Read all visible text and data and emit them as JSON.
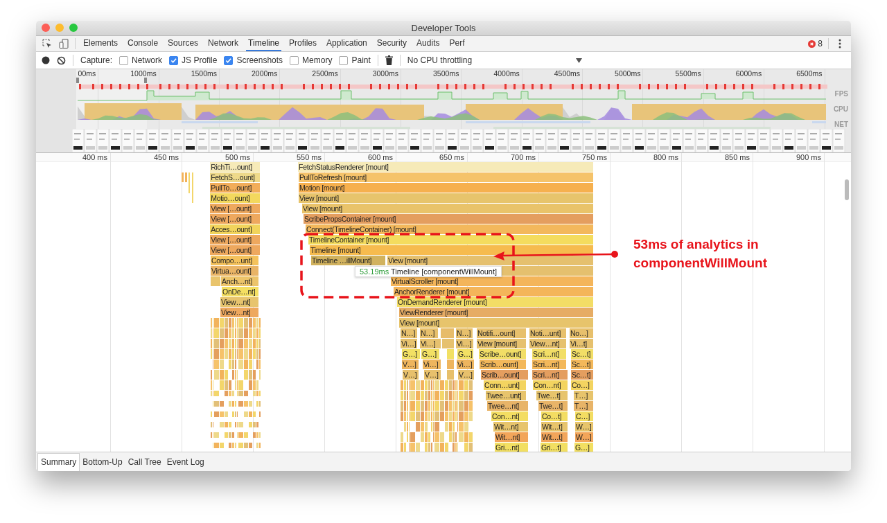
{
  "window": {
    "title": "Developer Tools"
  },
  "tabs": [
    {
      "label": "Elements",
      "selected": false
    },
    {
      "label": "Console",
      "selected": false
    },
    {
      "label": "Sources",
      "selected": false
    },
    {
      "label": "Network",
      "selected": false
    },
    {
      "label": "Timeline",
      "selected": true
    },
    {
      "label": "Profiles",
      "selected": false
    },
    {
      "label": "Application",
      "selected": false
    },
    {
      "label": "Security",
      "selected": false
    },
    {
      "label": "Audits",
      "selected": false
    },
    {
      "label": "Perf",
      "selected": false
    }
  ],
  "error_count": "8",
  "toolbar": {
    "capture_label": "Capture:",
    "options": [
      {
        "label": "Network",
        "checked": false
      },
      {
        "label": "JS Profile",
        "checked": true
      },
      {
        "label": "Screenshots",
        "checked": true
      },
      {
        "label": "Memory",
        "checked": false
      },
      {
        "label": "Paint",
        "checked": false
      }
    ],
    "throttling": "No CPU throttling"
  },
  "overview": {
    "ticks": [
      "00ms",
      "1000ms",
      "1500ms",
      "2000ms",
      "2500ms",
      "3000ms",
      "3500ms",
      "4000ms",
      "4500ms",
      "5000ms",
      "5500ms",
      "6000ms",
      "6500ms"
    ],
    "tracks": [
      "FPS",
      "CPU",
      "NET"
    ]
  },
  "flame_chart": {
    "ticks": [
      "400 ms",
      "450 ms",
      "500 ms",
      "550 ms",
      "600 ms",
      "650 ms",
      "700 ms",
      "750 ms",
      "800 ms",
      "850 ms",
      "900 ms"
    ],
    "rows": [
      [
        {
          "label": "RichTi…ount]",
          "color": "#f6eab8"
        },
        {
          "label": "FetchStatusRenderer [mount]",
          "color": "#f6eab8"
        }
      ],
      [
        {
          "label": "FetchS…ount]",
          "color": "#eed98a"
        },
        {
          "label": "PullToRefresh [mount]",
          "color": "#f5c36a"
        }
      ],
      [
        {
          "label": "PullTo…ount]",
          "color": "#f2ad5a"
        },
        {
          "label": "Motion [mount]",
          "color": "#f6b04e"
        }
      ],
      [
        {
          "label": "Motio…ount]",
          "color": "#f3d85e"
        },
        {
          "label": "View [mount]",
          "color": "#e7c46c"
        }
      ],
      [
        {
          "label": "View […ount]",
          "color": "#eea85e"
        },
        {
          "label": "View [mount]",
          "color": "#e9c36a"
        }
      ],
      [
        {
          "label": "View […ount]",
          "color": "#eea85e"
        },
        {
          "label": "ScribePropsContainer [mount]",
          "color": "#e49e5f"
        }
      ],
      [
        {
          "label": "Acces…ount]",
          "color": "#f1d45c"
        },
        {
          "label": "Connect(TimelineContainer) [mount]",
          "color": "#f3b85c"
        }
      ],
      [
        {
          "label": "View […ount]",
          "color": "#eea85e"
        },
        {
          "label": "TimelineContainer [mount]",
          "color": "#f4dc5e"
        }
      ],
      [
        {
          "label": "View […ount]",
          "color": "#eea85e"
        },
        {
          "label": "Timeline [mount]",
          "color": "#f6bb4e"
        }
      ],
      [
        {
          "label": "Compo…unt]",
          "color": "#f4c25c"
        },
        {
          "label": "Timeline …illMount]",
          "color": "#d1b25e"
        },
        {
          "label": "View [mount]",
          "color": "#e5c06e"
        }
      ],
      [
        {
          "label": "Virtua…ount]",
          "color": "#e9b466"
        },
        {}
      ],
      [
        {
          "color": "#e9c46c"
        },
        {
          "label": "Anch…nt]",
          "color": "#ecc46a"
        },
        {
          "label": "VirtualScroller [mount]",
          "color": "#f4b55a"
        }
      ],
      [
        {
          "label": "OnDe…nt]",
          "color": "#f4df62"
        },
        {
          "label": "AnchorRenderer [mount]",
          "color": "#f4b55a"
        }
      ],
      [
        {
          "label": "View…nt]",
          "color": "#e7c46e"
        },
        {
          "label": "OnDemandRenderer [mount]",
          "color": "#f3dd66"
        }
      ],
      [
        {
          "label": "View…nt]",
          "color": "#eea85e"
        },
        {
          "label": "ViewRenderer [mount]",
          "color": "#e6ac64"
        }
      ],
      [
        {
          "label": "View [mount]",
          "color": "#e7c46c"
        }
      ],
      [
        {
          "label": "N…]",
          "color": "#e7c06c"
        },
        {
          "label": "N…]",
          "color": "#e7c06c"
        },
        {
          "color": "#e7bc6a"
        },
        {
          "label": "N…]",
          "color": "#e7c06c"
        },
        {
          "label": "Notifi…ount]",
          "color": "#e7c06c"
        },
        {
          "label": "Noti…unt]",
          "color": "#e7c06c"
        },
        {
          "label": "No…]",
          "color": "#e7c06c"
        }
      ],
      [
        {
          "label": "Vi…]",
          "color": "#e6c16e"
        },
        {
          "label": "Vi…]",
          "color": "#e6c16e"
        },
        {
          "color": "#e6c16e"
        },
        {
          "label": "Vi…]",
          "color": "#e6c16e"
        },
        {
          "label": "View [mount]",
          "color": "#e6c16e"
        },
        {
          "label": "View…nt]",
          "color": "#e6c16e"
        },
        {
          "label": "Vi…t]",
          "color": "#e6c16e"
        }
      ],
      [
        {
          "label": "G…]",
          "color": "#f2e064"
        },
        {
          "label": "G…]",
          "color": "#f2e064"
        },
        {
          "color": "#f2e064"
        },
        {
          "label": "G…]",
          "color": "#f2e064"
        },
        {
          "label": "Scribe…ount]",
          "color": "#f2de66"
        },
        {
          "label": "Scri…nt]",
          "color": "#f2de66"
        },
        {
          "label": "Sc…t]",
          "color": "#f2de66"
        }
      ],
      [
        {
          "label": "V…]",
          "color": "#eeb55e"
        },
        {
          "label": "Vi…]",
          "color": "#eeb55e"
        },
        {
          "color": "#eeb55e"
        },
        {
          "label": "Vi…]",
          "color": "#eeb55e"
        },
        {
          "label": "Scrib…ount]",
          "color": "#f3b85a"
        },
        {
          "label": "Scri…nt]",
          "color": "#f3b85a"
        },
        {
          "label": "Sc…t]",
          "color": "#f3b85a"
        }
      ],
      [
        {
          "label": "V…]",
          "color": "#e7c06c"
        },
        {
          "label": "V…]",
          "color": "#e7c06c"
        },
        {
          "color": "#e7c06c"
        },
        {
          "label": "V…]",
          "color": "#e7c06c"
        },
        {
          "label": "Scrib…ount]",
          "color": "#e49e5f"
        },
        {
          "label": "Scri…nt]",
          "color": "#e49e5f"
        },
        {
          "label": "Sc…t]",
          "color": "#e49e5f"
        }
      ],
      [
        {
          "label": "Conn…unt]",
          "color": "#f3d460"
        },
        {
          "label": "Con…nt]",
          "color": "#f3d460"
        },
        {
          "label": "Co…]",
          "color": "#f3d460"
        }
      ],
      [
        {
          "label": "Twee…unt]",
          "color": "#e7c46c"
        },
        {
          "label": "Twe…t]",
          "color": "#e7c46c"
        },
        {
          "label": "T…]",
          "color": "#e7c46c"
        }
      ],
      [
        {
          "label": "Twee…nt]",
          "color": "#e8b468"
        },
        {
          "label": "Twe…t]",
          "color": "#e8b468"
        },
        {
          "label": "T…]",
          "color": "#e8b468"
        }
      ],
      [
        {
          "label": "Con…nt]",
          "color": "#f3dd62"
        },
        {
          "label": "Co…t]",
          "color": "#f3dd62"
        },
        {
          "label": "C…]",
          "color": "#f3dd62"
        }
      ],
      [
        {
          "label": "Wit…nt]",
          "color": "#e7c46c"
        },
        {
          "label": "Wit…t]",
          "color": "#e7c46c"
        },
        {
          "label": "W…]",
          "color": "#e7c46c"
        }
      ],
      [
        {
          "label": "Wit…nt]",
          "color": "#f2a55a"
        },
        {
          "label": "Wit…t]",
          "color": "#f2a55a"
        },
        {
          "label": "W…]",
          "color": "#f2a55a"
        }
      ],
      [
        {
          "label": "Gri…nt]",
          "color": "#f2df62"
        },
        {
          "label": "Gri…t]",
          "color": "#f2df62"
        },
        {
          "label": "G…]",
          "color": "#f2df62"
        }
      ]
    ],
    "tooltip": {
      "duration": "53.19ms",
      "name": "Timeline [componentWillMount]"
    }
  },
  "annotation": {
    "lines": [
      "53ms of analytics in",
      "componentWillMount"
    ]
  },
  "bottom_tabs": [
    {
      "label": "Summary",
      "selected": true
    },
    {
      "label": "Bottom-Up",
      "selected": false
    },
    {
      "label": "Call Tree",
      "selected": false
    },
    {
      "label": "Event Log",
      "selected": false
    }
  ]
}
